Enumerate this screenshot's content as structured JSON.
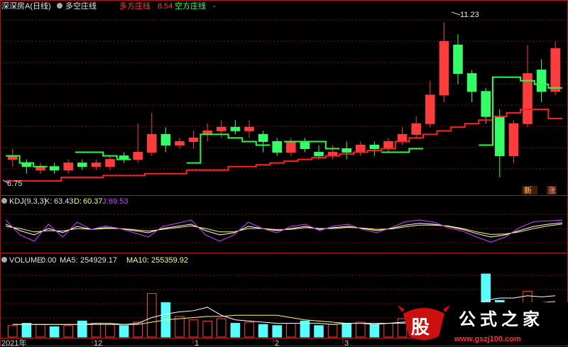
{
  "header": {
    "stock_name": "深深房A(日线)",
    "indicator_name": "多空庄线",
    "long_label": "多方庄线",
    "long_value": "8.54",
    "short_label": "空方庄线",
    "short_value": "-"
  },
  "kdj": {
    "label": "KDJ(9,3,3)",
    "k_label": "K:",
    "k_value": "63.43",
    "d_label": "D:",
    "d_value": "60.37",
    "j_label": "J:",
    "j_value": "69.53"
  },
  "volume": {
    "label": "VOLUME:",
    "value": "0.00",
    "ma5_label": "MA5:",
    "ma5_value": "254929.17",
    "ma10_label": "MA10:",
    "ma10_value": "255359.92"
  },
  "annotations": {
    "high": "11.23",
    "low": "6.75",
    "badge_new": "新",
    "badge_rise": "涨"
  },
  "x_axis": {
    "labels": [
      "2021年",
      "12",
      "1",
      "2",
      "3"
    ]
  },
  "watermark": {
    "logo_char": "股",
    "text": "公式之家",
    "url": "www.gszj100.com"
  },
  "colors": {
    "up": "#ff3c3c",
    "down": "#33ff66",
    "long_line": "#ff2020",
    "short_line": "#22ff44",
    "k_line": "#ffffff",
    "d_line": "#ffff66",
    "j_line": "#cc44ff",
    "vol_up": "#ff4040",
    "vol_down": "#55ffff",
    "grid": "#7a1010",
    "panel_border": "#b01818"
  },
  "chart_data": [
    {
      "type": "candlestick",
      "title": "深深房A(日线)",
      "ylim": [
        6.5,
        11.5
      ],
      "high_marker": 11.23,
      "low_marker": 6.75,
      "series": [
        {
          "name": "多方庄线",
          "values": [
            6.8,
            6.8,
            6.8,
            6.8,
            6.9,
            6.9,
            6.9,
            6.95,
            6.95,
            6.95,
            7.0,
            7.0,
            7.0,
            7.1,
            7.1,
            7.1,
            7.2,
            7.2,
            7.25,
            7.3,
            7.35,
            7.4,
            7.45,
            7.5,
            7.55,
            7.6,
            7.65,
            7.7,
            7.9,
            8.0,
            8.1,
            8.2,
            8.3,
            8.4,
            8.5,
            8.6,
            8.7,
            8.8,
            8.8,
            8.54
          ]
        },
        {
          "name": "空方庄线",
          "values": [
            7.5,
            7.3,
            7.2,
            7.6,
            7.6,
            7.5,
            7.4,
            7.3,
            8.1,
            8.1,
            8.0,
            7.9,
            7.8,
            7.9,
            7.9,
            7.9,
            7.7,
            7.6,
            7.6,
            7.7,
            7.8,
            9.7,
            9.7,
            9.6,
            9.5,
            9.4
          ]
        }
      ],
      "candles": [
        {
          "o": 7.4,
          "c": 7.5,
          "h": 7.7,
          "l": 7.2
        },
        {
          "o": 7.3,
          "c": 7.2,
          "h": 7.4,
          "l": 7.0
        },
        {
          "o": 7.1,
          "c": 7.2,
          "h": 7.3,
          "l": 7.0
        },
        {
          "o": 7.2,
          "c": 7.1,
          "h": 7.3,
          "l": 7.0
        },
        {
          "o": 7.1,
          "c": 7.3,
          "h": 7.4,
          "l": 7.0
        },
        {
          "o": 7.3,
          "c": 7.2,
          "h": 7.4,
          "l": 7.1
        },
        {
          "o": 7.2,
          "c": 7.3,
          "h": 7.4,
          "l": 7.1
        },
        {
          "o": 7.2,
          "c": 7.4,
          "h": 7.5,
          "l": 7.1
        },
        {
          "o": 7.5,
          "c": 7.4,
          "h": 7.6,
          "l": 7.3
        },
        {
          "o": 7.4,
          "c": 7.6,
          "h": 8.4,
          "l": 7.3
        },
        {
          "o": 7.6,
          "c": 8.1,
          "h": 8.7,
          "l": 7.5
        },
        {
          "o": 8.1,
          "c": 7.8,
          "h": 8.3,
          "l": 7.6
        },
        {
          "o": 7.8,
          "c": 7.9,
          "h": 8.0,
          "l": 7.7
        },
        {
          "o": 7.9,
          "c": 8.0,
          "h": 8.2,
          "l": 7.7
        },
        {
          "o": 8.1,
          "c": 8.2,
          "h": 8.4,
          "l": 7.9
        },
        {
          "o": 8.2,
          "c": 8.3,
          "h": 8.5,
          "l": 8.0
        },
        {
          "o": 8.3,
          "c": 8.2,
          "h": 8.5,
          "l": 8.1
        },
        {
          "o": 8.2,
          "c": 8.3,
          "h": 8.5,
          "l": 8.0
        },
        {
          "o": 8.1,
          "c": 7.9,
          "h": 8.2,
          "l": 7.6
        },
        {
          "o": 7.9,
          "c": 7.6,
          "h": 8.0,
          "l": 7.5
        },
        {
          "o": 7.6,
          "c": 7.9,
          "h": 8.0,
          "l": 7.5
        },
        {
          "o": 7.9,
          "c": 7.7,
          "h": 8.0,
          "l": 7.6
        },
        {
          "o": 7.6,
          "c": 7.5,
          "h": 7.8,
          "l": 7.4
        },
        {
          "o": 7.5,
          "c": 7.6,
          "h": 7.8,
          "l": 7.4
        },
        {
          "o": 7.7,
          "c": 7.6,
          "h": 7.9,
          "l": 7.4
        },
        {
          "o": 7.6,
          "c": 7.8,
          "h": 7.9,
          "l": 7.5
        },
        {
          "o": 7.8,
          "c": 7.7,
          "h": 7.9,
          "l": 7.5
        },
        {
          "o": 7.7,
          "c": 7.9,
          "h": 8.0,
          "l": 7.6
        },
        {
          "o": 7.9,
          "c": 8.1,
          "h": 8.3,
          "l": 7.8
        },
        {
          "o": 8.1,
          "c": 8.4,
          "h": 8.6,
          "l": 8.0
        },
        {
          "o": 8.4,
          "c": 9.2,
          "h": 9.6,
          "l": 8.3
        },
        {
          "o": 9.2,
          "c": 10.7,
          "h": 11.23,
          "l": 9.0
        },
        {
          "o": 10.6,
          "c": 9.8,
          "h": 10.9,
          "l": 9.5
        },
        {
          "o": 9.8,
          "c": 9.3,
          "h": 9.9,
          "l": 9.0
        },
        {
          "o": 9.3,
          "c": 8.6,
          "h": 9.4,
          "l": 8.4
        },
        {
          "o": 8.6,
          "c": 7.5,
          "h": 8.8,
          "l": 6.9
        },
        {
          "o": 7.5,
          "c": 8.4,
          "h": 8.5,
          "l": 7.3
        },
        {
          "o": 8.4,
          "c": 9.8,
          "h": 10.6,
          "l": 8.3
        },
        {
          "o": 9.9,
          "c": 9.3,
          "h": 10.2,
          "l": 9.0
        },
        {
          "o": 9.3,
          "c": 10.5,
          "h": 10.7,
          "l": 9.2
        }
      ]
    },
    {
      "type": "line",
      "title": "KDJ(9,3,3)",
      "ylim": [
        0,
        100
      ],
      "series": [
        {
          "name": "K",
          "values": [
            60,
            45,
            35,
            50,
            40,
            55,
            48,
            52,
            50,
            45,
            40,
            50,
            55,
            60,
            45,
            35,
            40,
            55,
            50,
            45,
            50,
            55,
            48,
            52,
            55,
            50,
            45,
            50,
            58,
            62,
            60,
            55,
            48,
            38,
            30,
            35,
            45,
            55,
            60,
            63.43
          ]
        },
        {
          "name": "D",
          "values": [
            55,
            50,
            42,
            45,
            44,
            50,
            48,
            50,
            50,
            47,
            44,
            48,
            52,
            56,
            50,
            42,
            42,
            50,
            50,
            47,
            48,
            52,
            50,
            50,
            53,
            51,
            48,
            49,
            54,
            58,
            58,
            56,
            50,
            42,
            36,
            37,
            42,
            50,
            56,
            60.37
          ]
        },
        {
          "name": "J",
          "values": [
            70,
            35,
            20,
            60,
            30,
            65,
            48,
            56,
            50,
            40,
            30,
            55,
            62,
            70,
            35,
            20,
            35,
            65,
            50,
            40,
            55,
            60,
            45,
            56,
            60,
            48,
            40,
            52,
            66,
            70,
            65,
            52,
            44,
            30,
            18,
            30,
            52,
            66,
            68,
            69.53
          ]
        }
      ]
    },
    {
      "type": "bar",
      "title": "VOLUME",
      "series": [
        {
          "name": "VOLUME",
          "values": [
            10,
            12,
            11,
            9,
            10,
            14,
            12,
            11,
            10,
            13,
            38,
            30,
            18,
            15,
            14,
            16,
            12,
            13,
            11,
            10,
            12,
            14,
            10,
            11,
            12,
            13,
            11,
            12,
            16,
            20,
            22,
            25,
            28,
            30,
            55,
            32,
            26,
            40,
            20,
            22
          ]
        },
        {
          "name": "MA5",
          "values": [
            11,
            11,
            11,
            11,
            11,
            11,
            12,
            12,
            11,
            12,
            17,
            20,
            22,
            23,
            26,
            19,
            15,
            14,
            13,
            12,
            12,
            12,
            12,
            11,
            12,
            12,
            11,
            12,
            13,
            14,
            17,
            20,
            23,
            25,
            32,
            34,
            34,
            36,
            35,
            36
          ]
        },
        {
          "name": "MA10",
          "values": [
            11,
            11,
            11,
            11,
            11,
            11,
            11,
            11,
            11,
            11,
            13,
            15,
            16,
            17,
            18,
            18,
            19,
            19,
            19,
            19,
            17,
            15,
            14,
            13,
            12,
            12,
            12,
            12,
            12,
            13,
            14,
            16,
            17,
            19,
            22,
            24,
            26,
            29,
            30,
            31
          ]
        }
      ]
    }
  ]
}
